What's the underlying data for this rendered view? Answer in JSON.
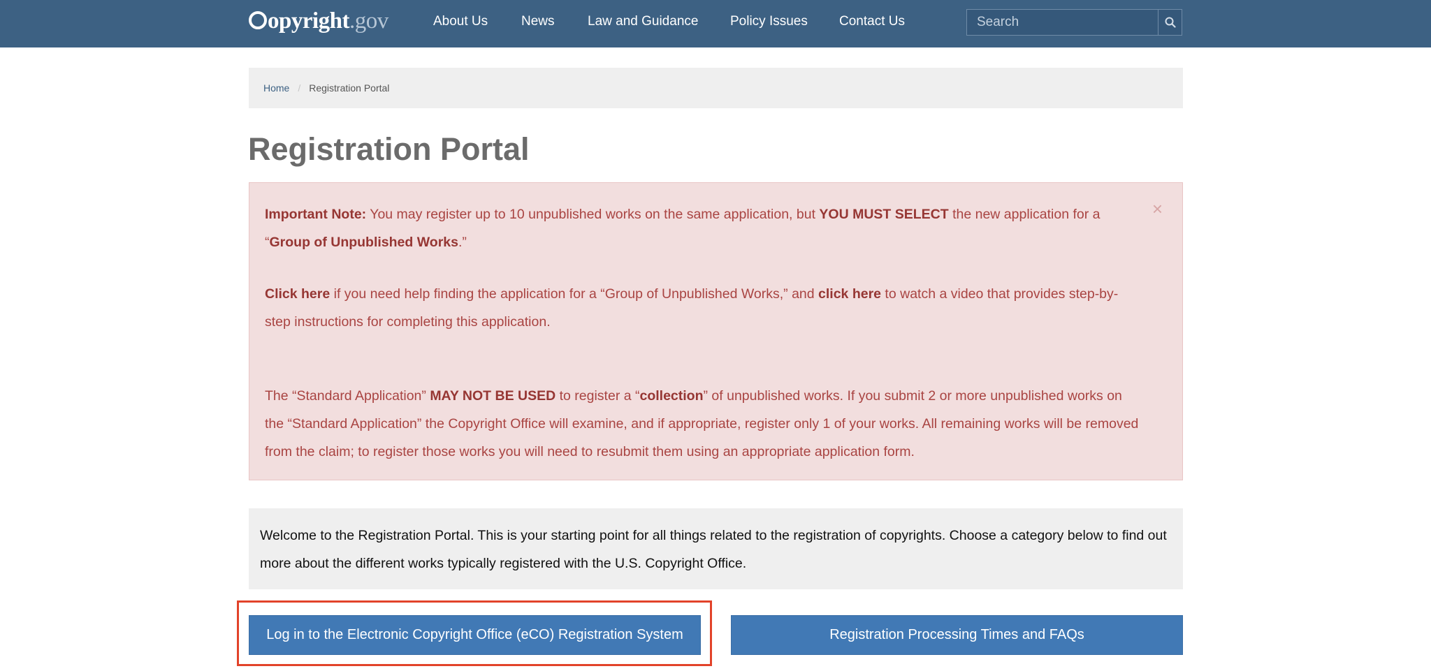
{
  "header": {
    "logo": {
      "main": "opyright",
      "suffix": ".gov"
    },
    "nav": [
      "About Us",
      "News",
      "Law and Guidance",
      "Policy Issues",
      "Contact Us"
    ],
    "search": {
      "placeholder": "Search"
    }
  },
  "breadcrumb": {
    "home": "Home",
    "separator": "/",
    "current": "Registration Portal"
  },
  "page_title": "Registration Portal",
  "alert": {
    "close": "×",
    "p1": {
      "lead": "Important Note:",
      "t1": " You may register up to 10 unpublished works on the same application, but ",
      "b1": "YOU MUST SELECT",
      "t2": " the new application for a “",
      "b2": "Group of Unpublished Works",
      "t3": ".”"
    },
    "p2": {
      "link1": "Click here",
      "t1": " if you need help finding the application for a “Group of Unpublished Works,” and ",
      "link2": "click here",
      "t2": " to watch a video that provides step-by-step instructions for completing this application."
    },
    "p3": {
      "t1": "The “Standard Application” ",
      "b1": "MAY NOT BE USED",
      "t2": " to register a “",
      "b2": "collection",
      "t3": "” of unpublished works. If you submit 2 or more unpublished works on the “Standard Application” the Copyright Office will examine, and if appropriate, register only 1 of your works. All remaining works will be removed from the claim; to register those works you will need to resubmit them using an appropriate application form."
    }
  },
  "welcome": "Welcome to the Registration Portal. This is your starting point for all things related to the registration of copyrights. Choose a category below to find out more about the different works typically registered with the U.S. Copyright Office.",
  "buttons": {
    "eco_login": "Log in to the Electronic Copyright Office (eCO) Registration System",
    "processing": "Registration Processing Times and FAQs"
  },
  "colors": {
    "header_bg": "#3d6183",
    "alert_bg": "#f2dede",
    "alert_text": "#a94442",
    "button_bg": "#4179b5",
    "highlight": "#e2432a"
  }
}
